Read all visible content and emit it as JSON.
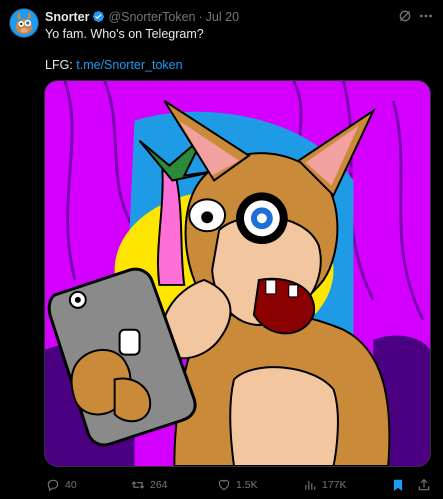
{
  "author": {
    "name": "Snorter",
    "handle": "@SnorterToken",
    "separator": "·",
    "date": "Jul 20"
  },
  "tweet": {
    "line1": "Yo fam. Who's on Telegram?",
    "line2_prefix": "LFG: ",
    "line2_link": "t.me/Snorter_token"
  },
  "actions": {
    "replies": "40",
    "reposts": "264",
    "likes": "1.5K",
    "views": "177K"
  },
  "icons": {
    "verified": "verified-badge-icon",
    "grok": "grok-icon",
    "more": "more-icon",
    "reply": "reply-icon",
    "repost": "repost-icon",
    "like": "heart-icon",
    "views": "views-icon",
    "bookmark": "bookmark-icon",
    "share": "share-icon"
  },
  "colors": {
    "background": "#000000",
    "text": "#e7e9ea",
    "muted": "#71767b",
    "accent": "#1d9bf0",
    "media_bg": "#d400ff"
  }
}
